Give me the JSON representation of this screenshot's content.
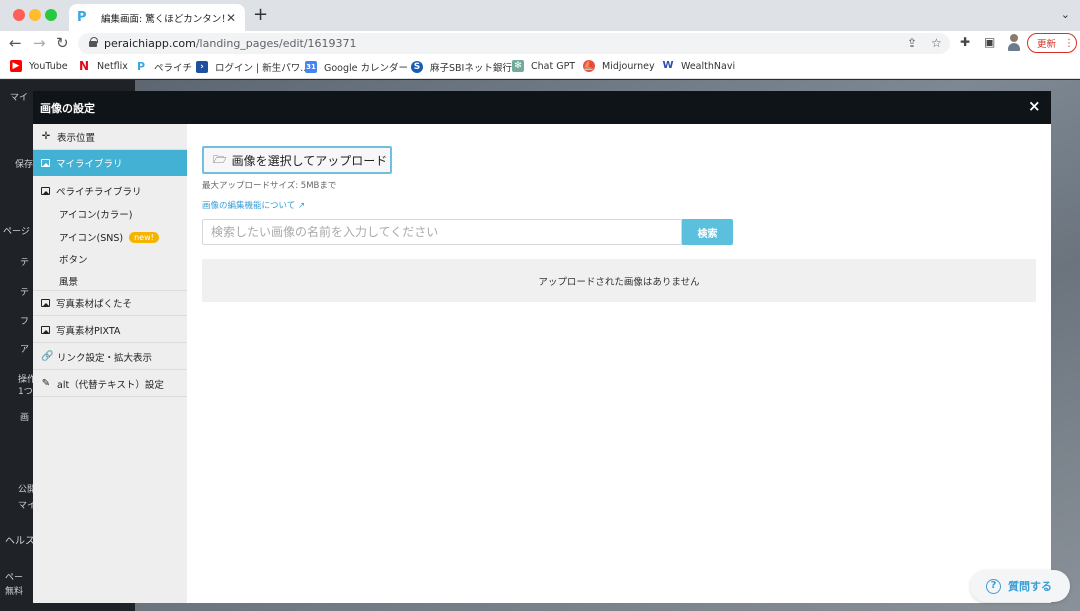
{
  "browser": {
    "tab_title": "編集画面: 驚くほどカンタン！無料",
    "tab_favicon": "P",
    "new_tab": "+",
    "url_host": "peraichiapp.com",
    "url_path": "/landing_pages/edit/1619371",
    "update_label": "更新"
  },
  "bookmarks": [
    {
      "label": "YouTube",
      "icon": "youtube-icon",
      "color": "#ff0000"
    },
    {
      "label": "Netflix",
      "icon": "netflix-icon",
      "color": "#e50914"
    },
    {
      "label": "ペライチ",
      "icon": "peraichi-icon",
      "color": "#3aa7e0"
    },
    {
      "label": "ログイン | 新生パワ...",
      "icon": "login-icon",
      "color": "#1e4fa0"
    },
    {
      "label": "Google カレンダー",
      "icon": "calendar-icon",
      "color": "#4285f4"
    },
    {
      "label": "麻子SBIネット銀行",
      "icon": "bank-icon",
      "color": "#1a5bb5"
    },
    {
      "label": "Chat GPT",
      "icon": "chatgpt-icon",
      "color": "#74aa9c"
    },
    {
      "label": "Midjourney",
      "icon": "midjourney-icon",
      "color": "#e84f3d"
    },
    {
      "label": "WealthNavi",
      "icon": "wealthnavi-icon",
      "color": "#2a4bb5"
    }
  ],
  "modal": {
    "title": "画像の設定",
    "close": "×"
  },
  "sidebar": {
    "items": [
      {
        "label": "表示位置",
        "icon": "move-icon"
      },
      {
        "label": "マイライブラリ",
        "icon": "image-icon",
        "active": true
      },
      {
        "label": "ペライチライブラリ",
        "icon": "image-icon"
      },
      {
        "label": "写真素材ぱくたそ",
        "icon": "image-icon"
      },
      {
        "label": "写真素材PIXTA",
        "icon": "image-icon"
      },
      {
        "label": "リンク設定・拡大表示",
        "icon": "link-icon"
      },
      {
        "label": "alt（代替テキスト）設定",
        "icon": "pencil-icon"
      }
    ],
    "sub_items": [
      {
        "label": "アイコン(カラー)"
      },
      {
        "label": "アイコン(SNS)",
        "badge": "new!"
      },
      {
        "label": "ボタン"
      },
      {
        "label": "風景"
      }
    ]
  },
  "content": {
    "upload_button": "画像を選択してアップロード",
    "max_size": "最大アップロードサイズ: 5MBまで",
    "edit_link": "画像の編集機能について",
    "search_placeholder": "検索したい画像の名前を入力してください",
    "search_button": "検索",
    "empty_message": "アップロードされた画像はありません"
  },
  "help": {
    "label": "質問する"
  },
  "background": {
    "fragments": [
      "マイ",
      "保存",
      "ページ",
      "テ",
      "テ",
      "フ",
      "ア",
      "操作",
      "1つ",
      "画",
      "公開",
      "マイ",
      "ヘルス",
      "ペー",
      "無料"
    ]
  },
  "colors": {
    "accent": "#42b1d3",
    "link": "#3a9fd6",
    "search_button": "#5bc0de",
    "badge": "#f5b400",
    "header": "#0e1418"
  }
}
